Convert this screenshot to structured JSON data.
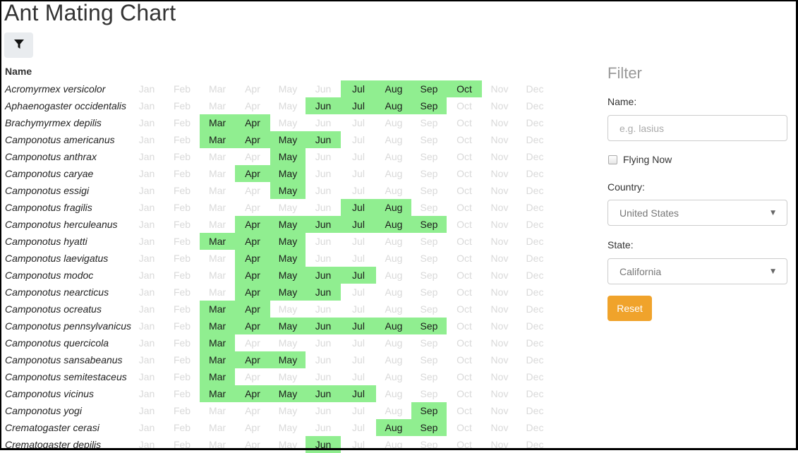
{
  "page": {
    "title": "Ant Mating Chart",
    "filter_toggle_icon": "filter-icon"
  },
  "table": {
    "name_header": "Name",
    "months": [
      "Jan",
      "Feb",
      "Mar",
      "Apr",
      "May",
      "Jun",
      "Jul",
      "Aug",
      "Sep",
      "Oct",
      "Nov",
      "Dec"
    ],
    "highlight_color": "#90ee90",
    "inactive_color": "#d9d9d9",
    "rows": [
      {
        "name": "Acromyrmex versicolor",
        "active": [
          7,
          8,
          9,
          10
        ]
      },
      {
        "name": "Aphaenogaster occidentalis",
        "active": [
          6,
          7,
          8,
          9
        ]
      },
      {
        "name": "Brachymyrmex depilis",
        "active": [
          3,
          4
        ]
      },
      {
        "name": "Camponotus americanus",
        "active": [
          3,
          4,
          5,
          6
        ]
      },
      {
        "name": "Camponotus anthrax",
        "active": [
          5
        ]
      },
      {
        "name": "Camponotus caryae",
        "active": [
          4,
          5
        ]
      },
      {
        "name": "Camponotus essigi",
        "active": [
          5
        ]
      },
      {
        "name": "Camponotus fragilis",
        "active": [
          7,
          8
        ]
      },
      {
        "name": "Camponotus herculeanus",
        "active": [
          4,
          5,
          6,
          7,
          8,
          9
        ]
      },
      {
        "name": "Camponotus hyatti",
        "active": [
          3,
          4,
          5
        ]
      },
      {
        "name": "Camponotus laevigatus",
        "active": [
          4,
          5
        ]
      },
      {
        "name": "Camponotus modoc",
        "active": [
          4,
          5,
          6,
          7
        ]
      },
      {
        "name": "Camponotus nearcticus",
        "active": [
          4,
          5,
          6
        ]
      },
      {
        "name": "Camponotus ocreatus",
        "active": [
          3,
          4
        ]
      },
      {
        "name": "Camponotus pennsylvanicus",
        "active": [
          3,
          4,
          5,
          6,
          7,
          8,
          9
        ]
      },
      {
        "name": "Camponotus quercicola",
        "active": [
          3
        ]
      },
      {
        "name": "Camponotus sansabeanus",
        "active": [
          3,
          4,
          5
        ]
      },
      {
        "name": "Camponotus semitestaceus",
        "active": [
          3
        ]
      },
      {
        "name": "Camponotus vicinus",
        "active": [
          3,
          4,
          5,
          6,
          7
        ]
      },
      {
        "name": "Camponotus yogi",
        "active": [
          9
        ]
      },
      {
        "name": "Crematogaster cerasi",
        "active": [
          8,
          9
        ]
      },
      {
        "name": "Crematogaster depilis",
        "active": [
          6
        ]
      }
    ]
  },
  "filter": {
    "title": "Filter",
    "name_label": "Name:",
    "name_placeholder": "e.g. lasius",
    "name_value": "",
    "flying_now_label": "Flying Now",
    "flying_now_checked": false,
    "country_label": "Country:",
    "country_value": "United States",
    "state_label": "State:",
    "state_value": "California",
    "reset_label": "Reset",
    "reset_color": "#f0a32b"
  }
}
